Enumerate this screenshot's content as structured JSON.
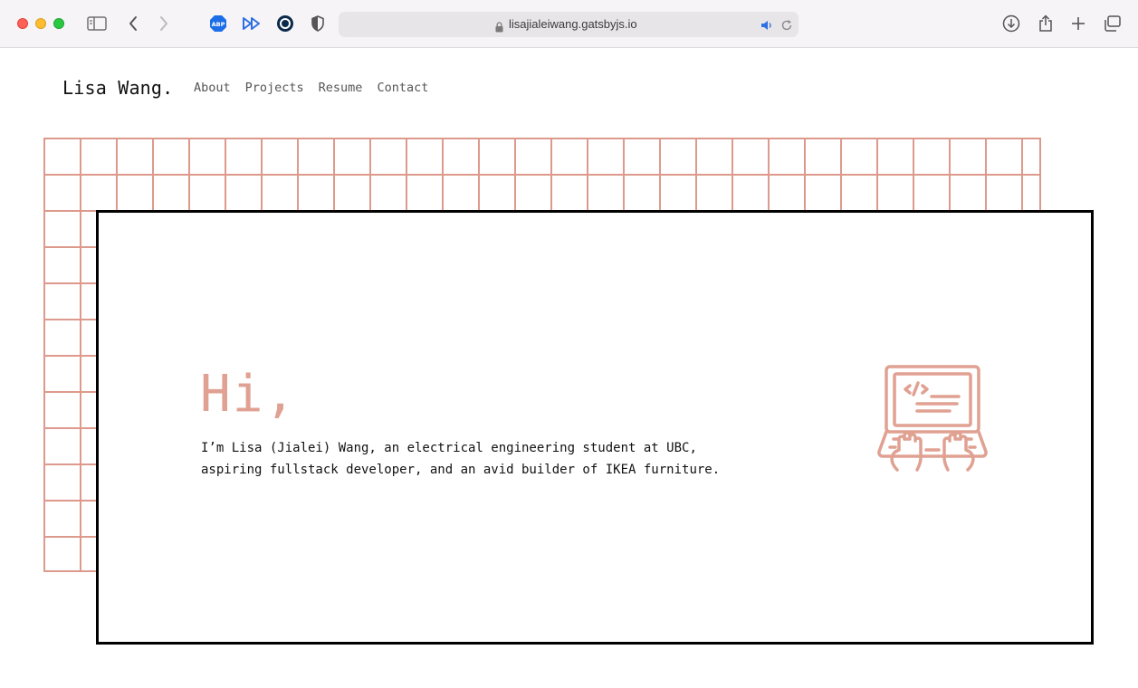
{
  "browser": {
    "url": "lisajialeiwang.gatsbyjs.io",
    "extensions": [
      "abp-icon",
      "fast-forward-icon",
      "onepassword-icon",
      "privacy-shield-icon"
    ]
  },
  "site": {
    "brand": "Lisa Wang.",
    "nav": [
      "About",
      "Projects",
      "Resume",
      "Contact"
    ]
  },
  "hero": {
    "greeting": "Hi,",
    "intro": "I’m Lisa (Jialei) Wang, an electrical engineering student at UBC, aspiring fullstack developer, and an avid builder of IKEA furniture.",
    "illustration": "laptop-coding-icon"
  },
  "colors": {
    "accent": "#e0a192",
    "grid": "#dd9a8c",
    "card_border": "#000000"
  }
}
